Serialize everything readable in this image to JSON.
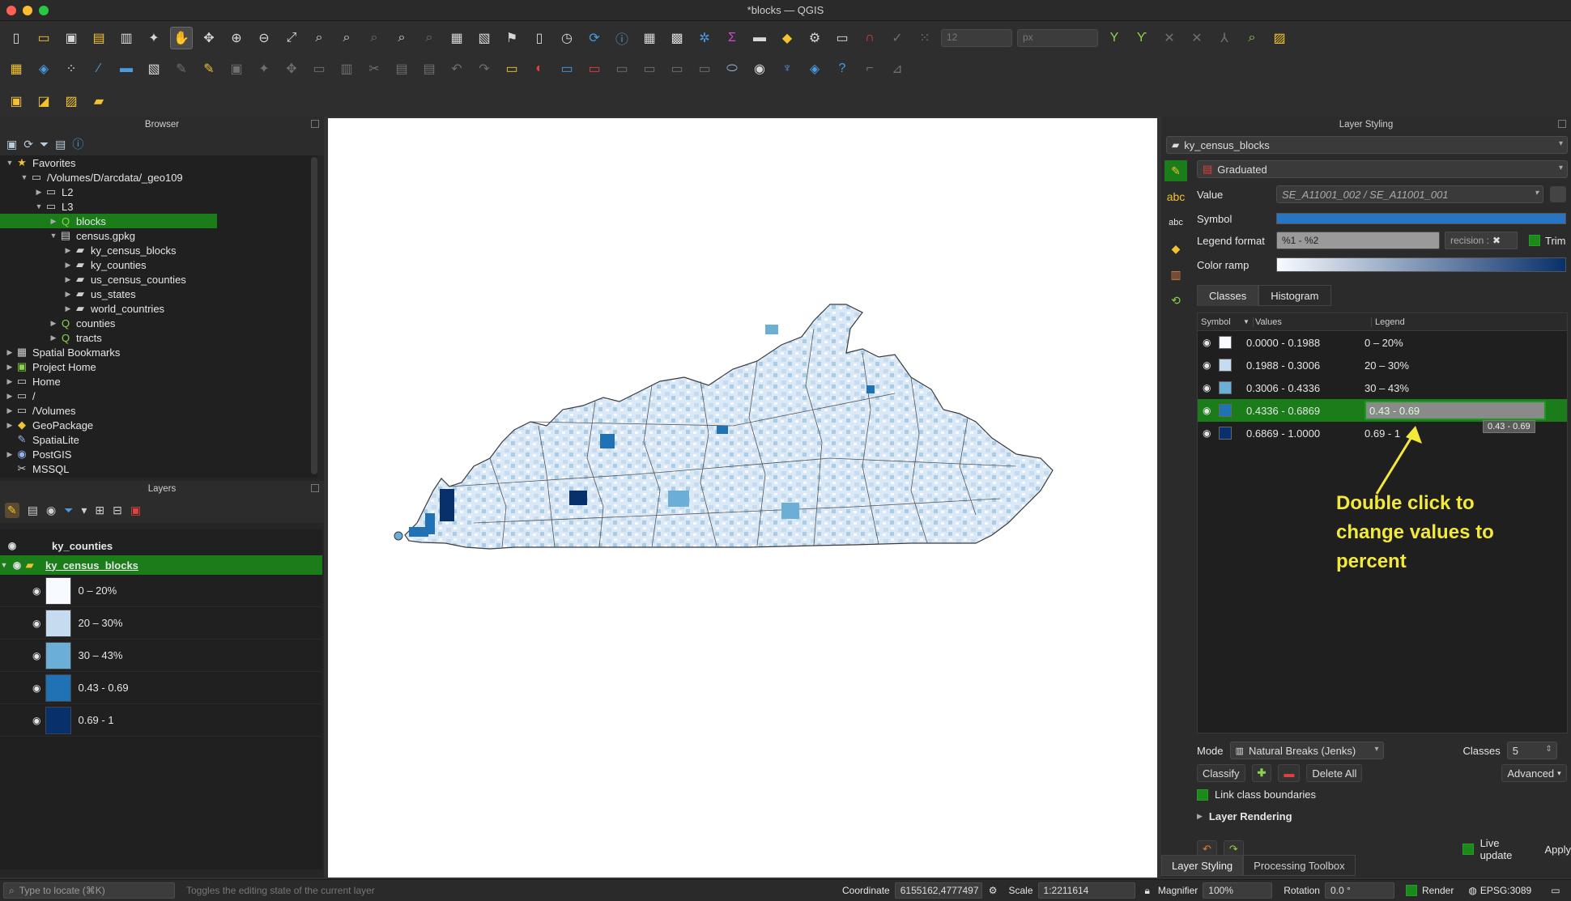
{
  "window": {
    "title": "*blocks — QGIS"
  },
  "toolbar": {
    "scale_field": "12",
    "unit_field": "px"
  },
  "browser": {
    "title": "Browser",
    "tree": [
      {
        "label": "Favorites",
        "icon": "star-icon",
        "glyph": "★",
        "color": "#f2c230",
        "level": 0,
        "arrow": "▼"
      },
      {
        "label": "/Volumes/D/arcdata/_geo109",
        "icon": "folder-icon",
        "glyph": "▭",
        "color": "#cfcfcf",
        "level": 1,
        "arrow": "▼"
      },
      {
        "label": "L2",
        "icon": "folder-icon",
        "glyph": "▭",
        "color": "#cfcfcf",
        "level": 2,
        "arrow": "▶"
      },
      {
        "label": "L3",
        "icon": "folder-icon",
        "glyph": "▭",
        "color": "#cfcfcf",
        "level": 2,
        "arrow": "▼"
      },
      {
        "label": "blocks",
        "icon": "qgis-project-icon",
        "glyph": "Q",
        "color": "#8bd34a",
        "level": 3,
        "arrow": "▶",
        "selected": true
      },
      {
        "label": "census.gpkg",
        "icon": "geopackage-icon",
        "glyph": "▤",
        "color": "#cfcfcf",
        "level": 3,
        "arrow": "▼"
      },
      {
        "label": "ky_census_blocks",
        "icon": "polygon-layer-icon",
        "glyph": "▰",
        "color": "#cfcfcf",
        "level": 4,
        "arrow": "▶"
      },
      {
        "label": "ky_counties",
        "icon": "polygon-layer-icon",
        "glyph": "▰",
        "color": "#cfcfcf",
        "level": 4,
        "arrow": "▶"
      },
      {
        "label": "us_census_counties",
        "icon": "polygon-layer-icon",
        "glyph": "▰",
        "color": "#cfcfcf",
        "level": 4,
        "arrow": "▶"
      },
      {
        "label": "us_states",
        "icon": "polygon-layer-icon",
        "glyph": "▰",
        "color": "#cfcfcf",
        "level": 4,
        "arrow": "▶"
      },
      {
        "label": "world_countries",
        "icon": "polygon-layer-icon",
        "glyph": "▰",
        "color": "#cfcfcf",
        "level": 4,
        "arrow": "▶"
      },
      {
        "label": "counties",
        "icon": "qgis-project-icon",
        "glyph": "Q",
        "color": "#8bd34a",
        "level": 3,
        "arrow": "▶"
      },
      {
        "label": "tracts",
        "icon": "qgis-project-icon",
        "glyph": "Q",
        "color": "#8bd34a",
        "level": 3,
        "arrow": "▶"
      },
      {
        "label": "Spatial Bookmarks",
        "icon": "bookmark-icon",
        "glyph": "▦",
        "color": "#cfcfcf",
        "level": 0,
        "arrow": "▶"
      },
      {
        "label": "Project Home",
        "icon": "project-home-icon",
        "glyph": "▣",
        "color": "#8bd34a",
        "level": 0,
        "arrow": "▶"
      },
      {
        "label": "Home",
        "icon": "home-folder-icon",
        "glyph": "▭",
        "color": "#cfcfcf",
        "level": 0,
        "arrow": "▶"
      },
      {
        "label": "/",
        "icon": "folder-icon",
        "glyph": "▭",
        "color": "#cfcfcf",
        "level": 0,
        "arrow": "▶"
      },
      {
        "label": "/Volumes",
        "icon": "folder-icon",
        "glyph": "▭",
        "color": "#cfcfcf",
        "level": 0,
        "arrow": "▶"
      },
      {
        "label": "GeoPackage",
        "icon": "geopackage-icon",
        "glyph": "◆",
        "color": "#f2c230",
        "level": 0,
        "arrow": "▶"
      },
      {
        "label": "SpatiaLite",
        "icon": "spatialite-icon",
        "glyph": "✎",
        "color": "#9ab4e0",
        "level": 0,
        "arrow": ""
      },
      {
        "label": "PostGIS",
        "icon": "postgis-icon",
        "glyph": "◉",
        "color": "#8fb3e8",
        "level": 0,
        "arrow": "▶"
      },
      {
        "label": "MSSQL",
        "icon": "mssql-icon",
        "glyph": "✂",
        "color": "#cfcfcf",
        "level": 0,
        "arrow": ""
      }
    ]
  },
  "layers": {
    "title": "Layers",
    "items": [
      {
        "name": "ky_counties",
        "selected": false
      },
      {
        "name": "ky_census_blocks",
        "selected": true
      }
    ],
    "legend": [
      {
        "label": "0 – 20%",
        "color": "#f7fbff"
      },
      {
        "label": "20 – 30%",
        "color": "#c6dbef"
      },
      {
        "label": "30 – 43%",
        "color": "#6baed6"
      },
      {
        "label": "0.43 - 0.69",
        "color": "#2171b5"
      },
      {
        "label": "0.69 - 1",
        "color": "#08306b"
      }
    ]
  },
  "styling": {
    "title": "Layer Styling",
    "layer": "ky_census_blocks",
    "renderer": "Graduated",
    "value_label": "Value",
    "value": "SE_A11001_002 / SE_A11001_001",
    "symbol_label": "Symbol",
    "legend_format_label": "Legend format",
    "legend_format": "%1 - %2",
    "precision": "recision :",
    "trim_label": "Trim",
    "color_ramp_label": "Color ramp",
    "tabs": [
      "Classes",
      "Histogram"
    ],
    "columns": [
      "Symbol",
      "Values",
      "Legend"
    ],
    "classes": [
      {
        "values": "0.0000 - 0.1988",
        "legend": "0 – 20%",
        "color": "#f7fbff"
      },
      {
        "values": "0.1988 - 0.3006",
        "legend": "20 – 30%",
        "color": "#c6dbef"
      },
      {
        "values": "0.3006 - 0.4336",
        "legend": "30 – 43%",
        "color": "#6baed6"
      },
      {
        "values": "0.4336 - 0.6869",
        "legend": "0.43 - 0.69",
        "color": "#2171b5",
        "editing": true
      },
      {
        "values": "0.6869 - 1.0000",
        "legend": "0.69 - 1",
        "color": "#08306b"
      }
    ],
    "tooltip": "0.43 - 0.69",
    "mode_label": "Mode",
    "mode": "Natural Breaks (Jenks)",
    "classes_label": "Classes",
    "classes_count": "5",
    "classify_label": "Classify",
    "delete_all_label": "Delete All",
    "advanced_label": "Advanced",
    "link_label": "Link class boundaries",
    "layer_rendering_label": "Layer Rendering",
    "live_update_label": "Live update",
    "apply_label": "Apply"
  },
  "bottom_tabs": [
    "Layer Styling",
    "Processing Toolbox"
  ],
  "annotation": "Double click to change values to percent",
  "status": {
    "locate_placeholder": "Type to locate (⌘K)",
    "message": "Toggles the editing state of the current layer",
    "coordinate_label": "Coordinate",
    "coordinate": "6155162,4777497",
    "scale_label": "Scale",
    "scale": "1:2211614",
    "magnifier_label": "Magnifier",
    "magnifier": "100%",
    "rotation_label": "Rotation",
    "rotation": "0.0 °",
    "render_label": "Render",
    "crs": "EPSG:3089"
  },
  "colors": {
    "selection_green": "#1a7d1a",
    "annotation_yellow": "#f2e93a",
    "ramp_start": "#f7fbff",
    "ramp_end": "#08306b"
  }
}
